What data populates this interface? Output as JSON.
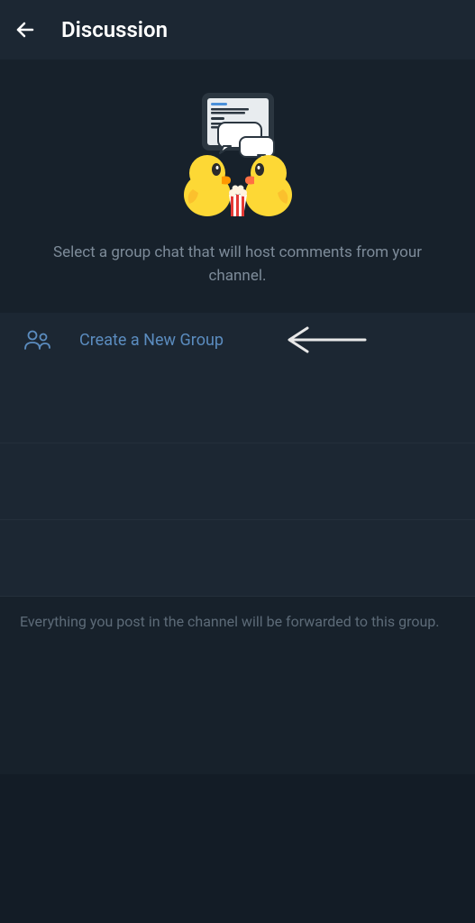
{
  "header": {
    "title": "Discussion"
  },
  "topInfo": "Select a group chat that will host comments from your channel.",
  "createGroup": {
    "label": "Create a New Group"
  },
  "bottomInfo": "Everything you post in the channel will be forwarded to this group.",
  "colors": {
    "accent": "#5b8cbf",
    "muted": "#7d8b99"
  }
}
